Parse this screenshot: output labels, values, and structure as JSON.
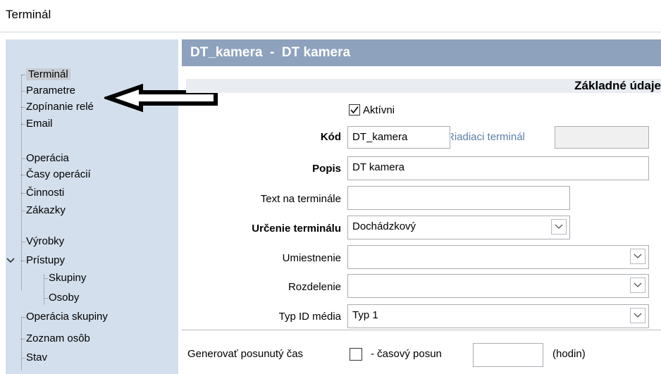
{
  "window": {
    "title": "Terminál"
  },
  "header": {
    "title": "DT_kamera  -  DT kamera"
  },
  "sidebar": {
    "items": [
      {
        "label": "Terminál"
      },
      {
        "label": "Parametre"
      },
      {
        "label": "Zopínanie relé"
      },
      {
        "label": "Email"
      },
      {
        "label": "Operácia"
      },
      {
        "label": "Časy operácií"
      },
      {
        "label": "Činnosti"
      },
      {
        "label": "Zákazky"
      },
      {
        "label": "Výrobky"
      },
      {
        "label": "Prístupy"
      },
      {
        "label": "Skupiny"
      },
      {
        "label": "Osoby"
      },
      {
        "label": "Operácia skupiny"
      },
      {
        "label": "Zoznam osôb"
      },
      {
        "label": "Stav"
      }
    ],
    "selected": "Terminál"
  },
  "form": {
    "section_title": "Základné údaje",
    "active": {
      "label": "Aktívni",
      "checked": true
    },
    "kod": {
      "label": "Kód",
      "value": "DT_kamera"
    },
    "riadiaci": {
      "label": "Riadiaci terminál",
      "value": ""
    },
    "popis": {
      "label": "Popis",
      "value": "DT kamera"
    },
    "text_na_terminale": {
      "label": "Text na terminále",
      "value": ""
    },
    "urcenie": {
      "label": "Určenie terminálu",
      "value": "Dochádzkový"
    },
    "umiestnenie": {
      "label": "Umiestnenie",
      "value": ""
    },
    "rozdelenie": {
      "label": "Rozdelenie",
      "value": ""
    },
    "typ_id": {
      "label": "Typ ID média",
      "value": "Typ 1"
    },
    "generovat": {
      "label": "Generovať posunutý čas",
      "checked": false
    },
    "casovy_posun": {
      "label": "- časový posun",
      "value": "",
      "unit": "(hodin)"
    }
  }
}
